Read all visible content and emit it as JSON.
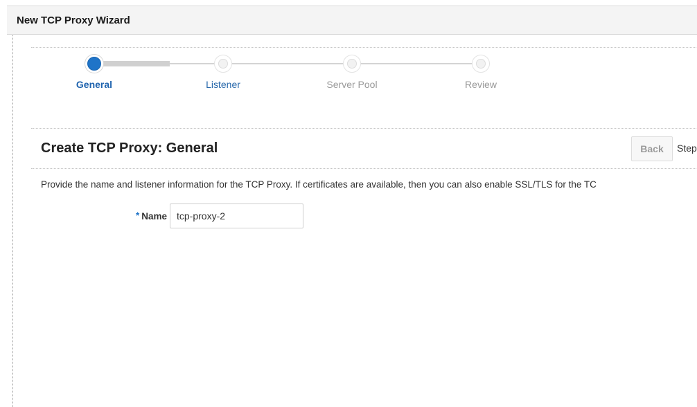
{
  "window": {
    "title": "New TCP Proxy Wizard"
  },
  "train": {
    "stops": [
      {
        "label": "General",
        "state": "current"
      },
      {
        "label": "Listener",
        "state": "next"
      },
      {
        "label": "Server Pool",
        "state": "disabled"
      },
      {
        "label": "Review",
        "state": "disabled"
      }
    ]
  },
  "page": {
    "header": "Create TCP Proxy: General",
    "back_label": "Back",
    "step_text": "Step",
    "instructions": "Provide the name and listener information for the TCP Proxy. If certificates are available, then you can also enable SSL/TLS for the TC"
  },
  "form": {
    "name": {
      "required_mark": "*",
      "label": "Name",
      "value": "tcp-proxy-2"
    }
  },
  "colors": {
    "accent": "#1f74c8",
    "current_label": "#1f63ae",
    "disabled_label": "#999999"
  }
}
